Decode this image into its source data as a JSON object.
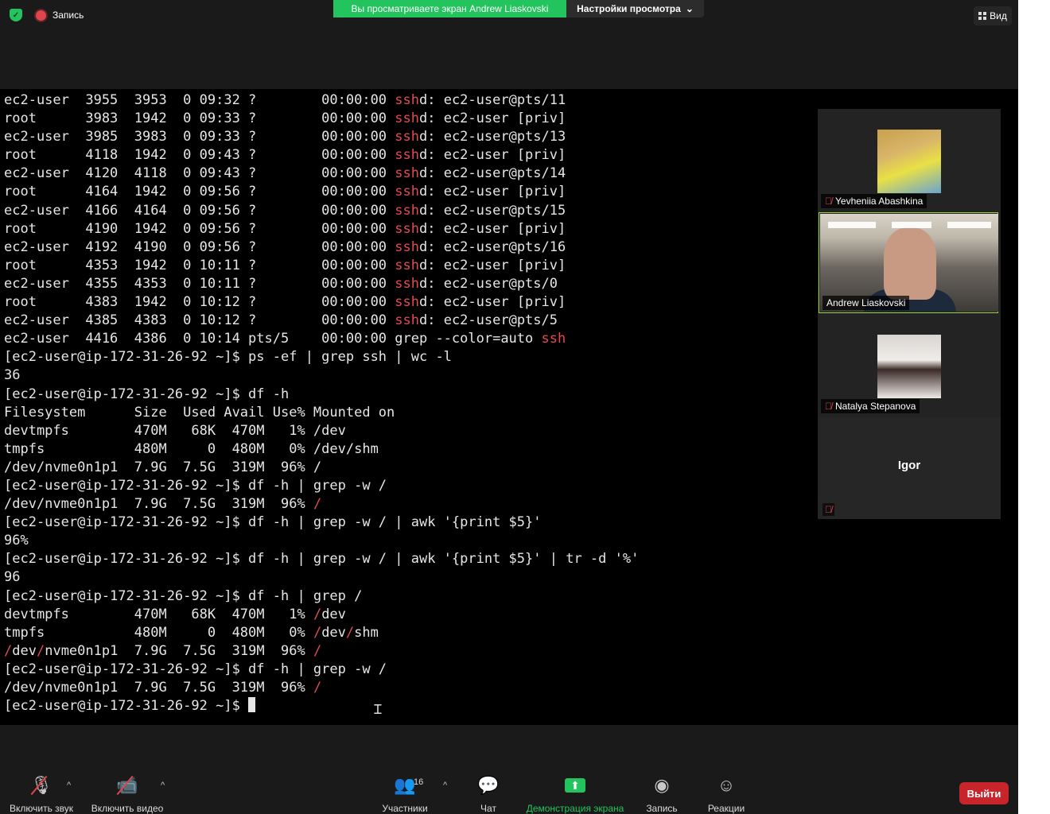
{
  "top": {
    "record_label": "Запись",
    "viewing_banner": "Вы просматриваете экран Andrew Liaskovski",
    "view_settings": "Настройки просмотра",
    "view_label": "Вид"
  },
  "terminal": {
    "lines": [
      [
        {
          "t": "ec2-user  3955  3953  0 09:32 ?        00:00:00 "
        },
        {
          "t": "ssh",
          "hl": true
        },
        {
          "t": "d: ec2-user@pts/11"
        }
      ],
      [
        {
          "t": "root      3983  1942  0 09:33 ?        00:00:00 "
        },
        {
          "t": "ssh",
          "hl": true
        },
        {
          "t": "d: ec2-user [priv]"
        }
      ],
      [
        {
          "t": "ec2-user  3985  3983  0 09:33 ?        00:00:00 "
        },
        {
          "t": "ssh",
          "hl": true
        },
        {
          "t": "d: ec2-user@pts/13"
        }
      ],
      [
        {
          "t": "root      4118  1942  0 09:43 ?        00:00:00 "
        },
        {
          "t": "ssh",
          "hl": true
        },
        {
          "t": "d: ec2-user [priv]"
        }
      ],
      [
        {
          "t": "ec2-user  4120  4118  0 09:43 ?        00:00:00 "
        },
        {
          "t": "ssh",
          "hl": true
        },
        {
          "t": "d: ec2-user@pts/14"
        }
      ],
      [
        {
          "t": "root      4164  1942  0 09:56 ?        00:00:00 "
        },
        {
          "t": "ssh",
          "hl": true
        },
        {
          "t": "d: ec2-user [priv]"
        }
      ],
      [
        {
          "t": "ec2-user  4166  4164  0 09:56 ?        00:00:00 "
        },
        {
          "t": "ssh",
          "hl": true
        },
        {
          "t": "d: ec2-user@pts/15"
        }
      ],
      [
        {
          "t": "root      4190  1942  0 09:56 ?        00:00:00 "
        },
        {
          "t": "ssh",
          "hl": true
        },
        {
          "t": "d: ec2-user [priv]"
        }
      ],
      [
        {
          "t": "ec2-user  4192  4190  0 09:56 ?        00:00:00 "
        },
        {
          "t": "ssh",
          "hl": true
        },
        {
          "t": "d: ec2-user@pts/16"
        }
      ],
      [
        {
          "t": "root      4353  1942  0 10:11 ?        00:00:00 "
        },
        {
          "t": "ssh",
          "hl": true
        },
        {
          "t": "d: ec2-user [priv]"
        }
      ],
      [
        {
          "t": "ec2-user  4355  4353  0 10:11 ?        00:00:00 "
        },
        {
          "t": "ssh",
          "hl": true
        },
        {
          "t": "d: ec2-user@pts/0"
        }
      ],
      [
        {
          "t": "root      4383  1942  0 10:12 ?        00:00:00 "
        },
        {
          "t": "ssh",
          "hl": true
        },
        {
          "t": "d: ec2-user [priv]"
        }
      ],
      [
        {
          "t": "ec2-user  4385  4383  0 10:12 ?        00:00:00 "
        },
        {
          "t": "ssh",
          "hl": true
        },
        {
          "t": "d: ec2-user@pts/5"
        }
      ],
      [
        {
          "t": "ec2-user  4416  4386  0 10:14 pts/5    00:00:00 grep --color=auto "
        },
        {
          "t": "ssh",
          "hl": true
        }
      ],
      [
        {
          "t": "[ec2-user@ip-172-31-26-92 ~]$ ps -ef | grep ssh | wc -l"
        }
      ],
      [
        {
          "t": "36"
        }
      ],
      [
        {
          "t": "[ec2-user@ip-172-31-26-92 ~]$ df -h"
        }
      ],
      [
        {
          "t": "Filesystem      Size  Used Avail Use% Mounted on"
        }
      ],
      [
        {
          "t": "devtmpfs        470M   68K  470M   1% /dev"
        }
      ],
      [
        {
          "t": "tmpfs           480M     0  480M   0% /dev/shm"
        }
      ],
      [
        {
          "t": "/dev/nvme0n1p1  7.9G  7.5G  319M  96% /"
        }
      ],
      [
        {
          "t": "[ec2-user@ip-172-31-26-92 ~]$ df -h | grep -w /"
        }
      ],
      [
        {
          "t": "/dev/nvme0n1p1  7.9G  7.5G  319M  96% "
        },
        {
          "t": "/",
          "hl": true
        }
      ],
      [
        {
          "t": "[ec2-user@ip-172-31-26-92 ~]$ df -h | grep -w / | awk '{print $5}'"
        }
      ],
      [
        {
          "t": "96%"
        }
      ],
      [
        {
          "t": "[ec2-user@ip-172-31-26-92 ~]$ df -h | grep -w / | awk '{print $5}' | tr -d '%'"
        }
      ],
      [
        {
          "t": "96"
        }
      ],
      [
        {
          "t": "[ec2-user@ip-172-31-26-92 ~]$ df -h | grep /"
        }
      ],
      [
        {
          "t": "devtmpfs        470M   68K  470M   1% "
        },
        {
          "t": "/",
          "hl": true
        },
        {
          "t": "dev"
        }
      ],
      [
        {
          "t": "tmpfs           480M     0  480M   0% "
        },
        {
          "t": "/",
          "hl": true
        },
        {
          "t": "dev"
        },
        {
          "t": "/",
          "hl": true
        },
        {
          "t": "shm"
        }
      ],
      [
        {
          "t": "/",
          "hl": true
        },
        {
          "t": "dev"
        },
        {
          "t": "/",
          "hl": true
        },
        {
          "t": "nvme0n1p1  7.9G  7.5G  319M  96% "
        },
        {
          "t": "/",
          "hl": true
        }
      ],
      [
        {
          "t": "[ec2-user@ip-172-31-26-92 ~]$ df -h | grep -w /"
        }
      ],
      [
        {
          "t": "/dev/nvme0n1p1  7.9G  7.5G  319M  96% "
        },
        {
          "t": "/",
          "hl": true
        }
      ],
      [
        {
          "t": "[ec2-user@ip-172-31-26-92 ~]$ "
        },
        {
          "cursor": true
        }
      ]
    ]
  },
  "participants": {
    "p1": "Yevheniia Abashkina",
    "p2": "Andrew Liaskovski",
    "p3": "Natalya Stepanova",
    "p4": "Igor"
  },
  "toolbar": {
    "mute": "Включить звук",
    "video": "Включить видео",
    "participants": "Участники",
    "participants_count": "16",
    "chat": "Чат",
    "share": "Демонстрация экрана",
    "record": "Запись",
    "reactions": "Реакции",
    "leave": "Выйти"
  },
  "colors": {
    "accent_green": "#23c45e",
    "highlight_red": "#e34a52",
    "leave_red": "#c8242b"
  }
}
